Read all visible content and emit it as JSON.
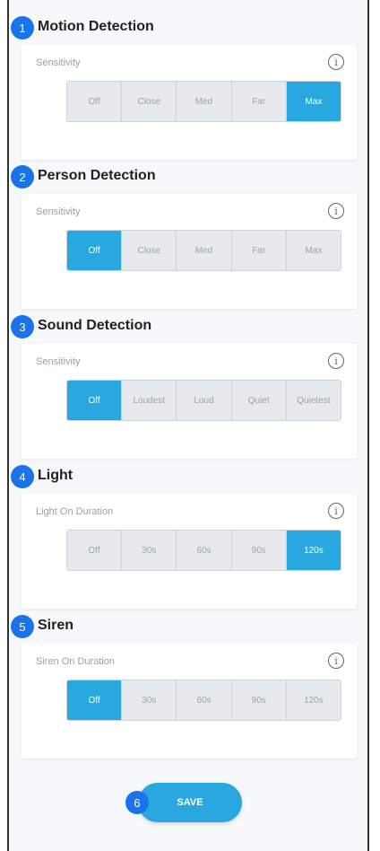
{
  "sections": [
    {
      "number": "1",
      "title": "Motion Detection",
      "label": "Sensitivity",
      "options": [
        "Off",
        "Close",
        "Med",
        "Far",
        "Max"
      ],
      "selected": 4
    },
    {
      "number": "2",
      "title": "Person Detection",
      "label": "Sensitivity",
      "options": [
        "Off",
        "Close",
        "Med",
        "Far",
        "Max"
      ],
      "selected": 0
    },
    {
      "number": "3",
      "title": "Sound Detection",
      "label": "Sensitivity",
      "options": [
        "Off",
        "Loudest",
        "Loud",
        "Quiet",
        "Quietest"
      ],
      "selected": 0
    },
    {
      "number": "4",
      "title": "Light",
      "label": "Light On Duration",
      "options": [
        "Off",
        "30s",
        "60s",
        "90s",
        "120s"
      ],
      "selected": 4
    },
    {
      "number": "5",
      "title": "Siren",
      "label": "Siren On Duration",
      "options": [
        "Off",
        "30s",
        "60s",
        "90s",
        "120s"
      ],
      "selected": 0
    }
  ],
  "info_glyph": "i",
  "save": {
    "number": "6",
    "label": "SAVE"
  },
  "colors": {
    "accent": "#29a8e0",
    "badge": "#1a73e8"
  }
}
